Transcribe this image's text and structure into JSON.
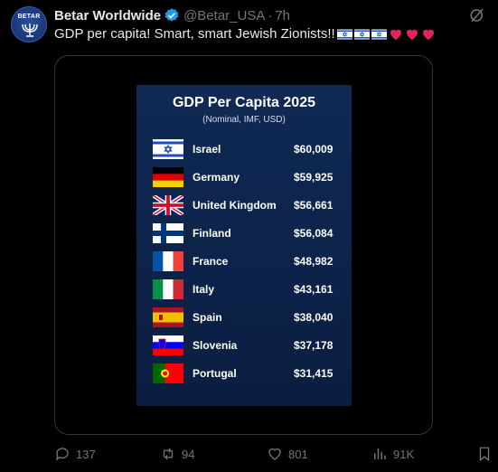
{
  "post": {
    "author_name": "Betar Worldwide",
    "handle": "@Betar_USA",
    "separator": "·",
    "time": "7h",
    "text": "GDP per capita! Smart, smart Jewish Zionists!!",
    "avatar_text": "BETAR",
    "trailing_emojis": [
      "israel-flag-emoji",
      "israel-flag-emoji",
      "israel-flag-emoji",
      "red-heart-emoji",
      "red-heart-emoji",
      "red-heart-emoji"
    ]
  },
  "image": {
    "title": "GDP Per Capita 2025",
    "subtitle": "(Nominal, IMF, USD)",
    "rows": [
      {
        "country": "Israel",
        "value": "$60,009",
        "flag": "israel-flag"
      },
      {
        "country": "Germany",
        "value": "$59,925",
        "flag": "germany-flag"
      },
      {
        "country": "United Kingdom",
        "value": "$56,661",
        "flag": "uk-flag"
      },
      {
        "country": "Finland",
        "value": "$56,084",
        "flag": "finland-flag"
      },
      {
        "country": "France",
        "value": "$48,982",
        "flag": "france-flag"
      },
      {
        "country": "Italy",
        "value": "$43,161",
        "flag": "italy-flag"
      },
      {
        "country": "Spain",
        "value": "$38,040",
        "flag": "spain-flag"
      },
      {
        "country": "Slovenia",
        "value": "$37,178",
        "flag": "slovenia-flag"
      },
      {
        "country": "Portugal",
        "value": "$31,415",
        "flag": "portugal-flag"
      }
    ]
  },
  "actions": {
    "replies": "137",
    "reposts": "94",
    "likes": "801",
    "views": "91K"
  },
  "colors": {
    "background": "#000000",
    "muted_text": "#71767b",
    "verified_blue": "#1d9bf0",
    "card_blue": "#0e2650"
  }
}
